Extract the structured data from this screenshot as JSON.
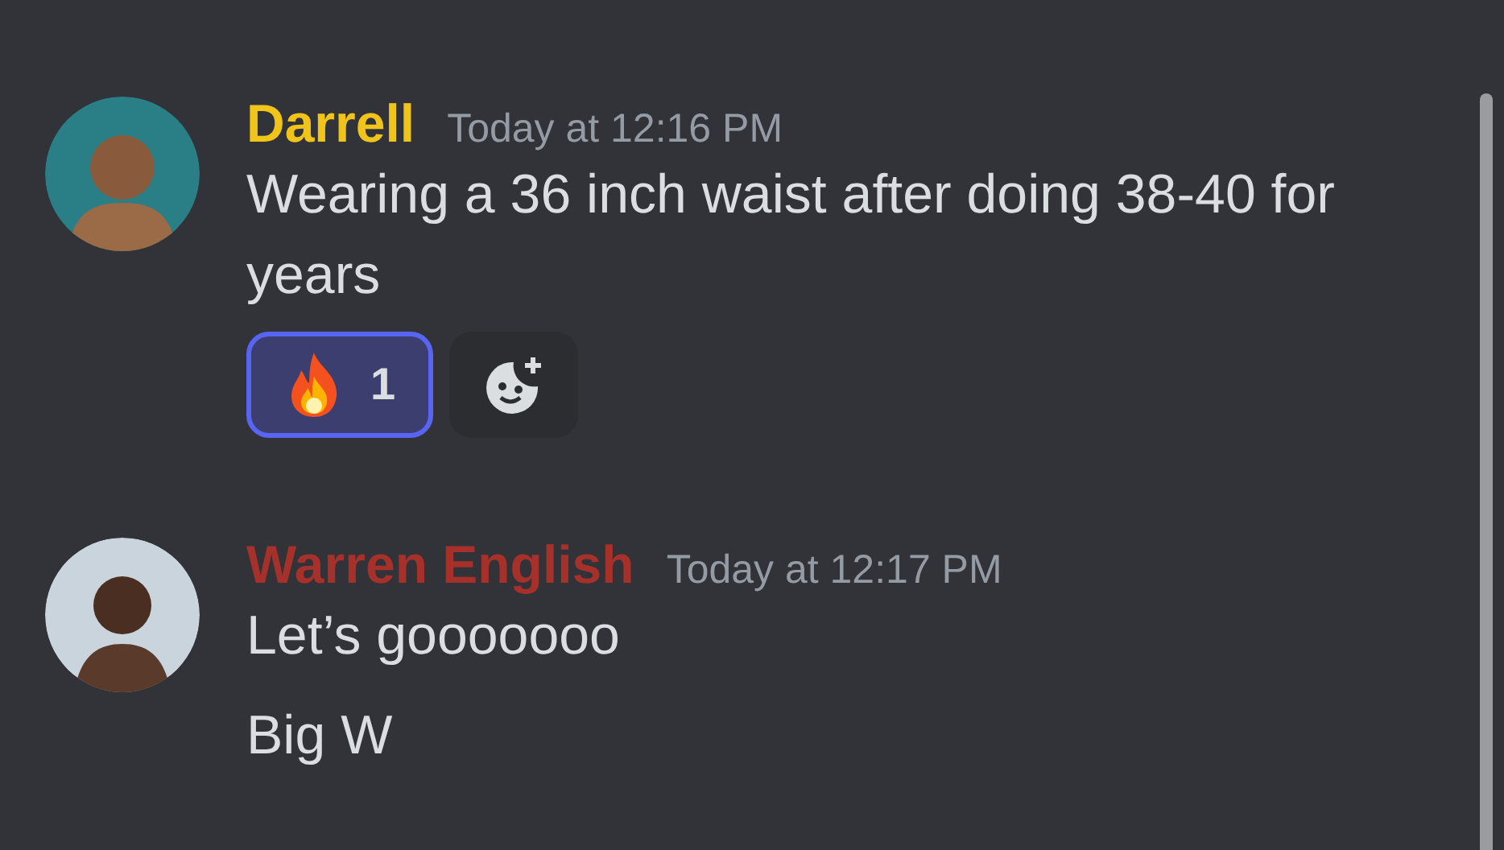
{
  "messages": [
    {
      "author": "Darrell",
      "color": "#f0c419",
      "timestamp": "Today at 12:16 PM",
      "lines": [
        "Wearing a 36 inch waist after doing 38-40 for years"
      ],
      "reactions": [
        {
          "count": "1",
          "selected": true
        }
      ]
    },
    {
      "author": "Warren English",
      "color": "#a6302a",
      "timestamp": "Today at 12:17 PM",
      "lines": [
        "Let’s gooooooo",
        "Big W"
      ]
    }
  ]
}
